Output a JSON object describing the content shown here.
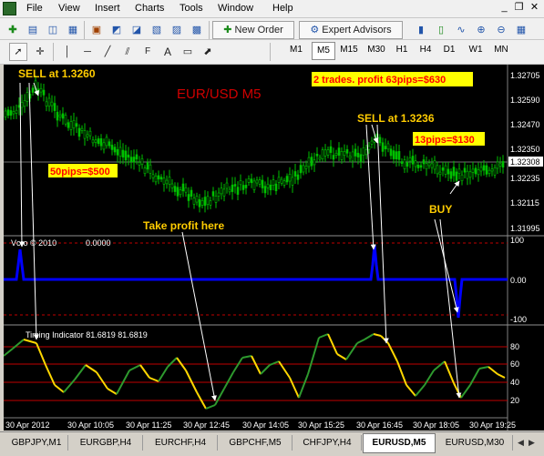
{
  "menu": {
    "items": [
      "File",
      "View",
      "Insert",
      "Charts",
      "Tools",
      "Window",
      "Help"
    ]
  },
  "window_controls": {
    "minimize": "_",
    "restore": "❐",
    "close": "✕"
  },
  "toolbar": {
    "new_order": "New Order",
    "expert_advisors": "Expert Advisors"
  },
  "timeframes": [
    "M1",
    "M5",
    "M15",
    "M30",
    "H1",
    "H4",
    "D1",
    "W1",
    "MN"
  ],
  "active_timeframe": "M5",
  "chart": {
    "symbol_label": "EUR/USD M5",
    "price_axis": [
      "1.32705",
      "1.32590",
      "1.32470",
      "1.32350",
      "1.32308",
      "1.32235",
      "1.32115",
      "1.31995"
    ],
    "current_price": "1.32308",
    "indicator1": {
      "title": "Vcro © 2010",
      "value": "0.0000",
      "axis": [
        "100",
        "0.00",
        "-100"
      ]
    },
    "indicator2": {
      "title": "Timing Indicator 81.6819 81.6819",
      "axis": [
        "80",
        "60",
        "40",
        "20"
      ]
    },
    "time_axis": [
      "30 Apr 2012",
      "30 Apr 10:05",
      "30 Apr 11:25",
      "30 Apr 12:45",
      "30 Apr 14:05",
      "30 Apr 15:25",
      "30 Apr 16:45",
      "30 Apr 18:05",
      "30 Apr 19:25"
    ],
    "annotations": {
      "sell1": "SELL  at 1.3260",
      "pips50": "50pips=$500",
      "take_profit": "Take profit here",
      "trades": "2 trades. profit 63pips=$630",
      "sell2": "SELL at 1.3236",
      "pips13": "13pips=$130",
      "buy": "BUY"
    }
  },
  "colors": {
    "candles": "#00c000",
    "annotation_text": "#ffcc00",
    "highlight_bg": "#ffff00",
    "highlight_text": "#ff0000",
    "symbol_label": "#d00000",
    "vcro_line": "#0000ff",
    "timing_up": "#2e9a2e",
    "timing_down": "#ffd700",
    "level_lines": "#c00000"
  },
  "tabs": {
    "items": [
      "GBPJPY,M1",
      "EURGBP,H4",
      "EURCHF,H4",
      "GBPCHF,M5",
      "CHFJPY,H4",
      "EURUSD,M5",
      "EURUSD,M30"
    ],
    "active": "EURUSD,M5"
  }
}
